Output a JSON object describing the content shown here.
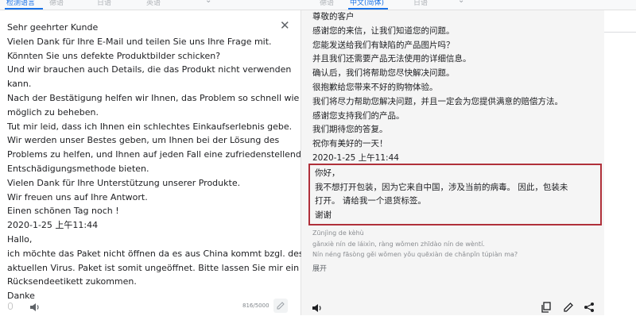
{
  "tabs": [
    {
      "label": "检测语言",
      "active": true
    },
    {
      "label": "德语"
    },
    {
      "label": "日语"
    },
    {
      "label": "英语"
    },
    {
      "label": "德语"
    },
    {
      "label": "中文(简体)",
      "active": true
    },
    {
      "label": "日语"
    }
  ],
  "source": {
    "lines": [
      "Sehr geehrter Kunde",
      "Vielen Dank für Ihre E-Mail und teilen Sie uns Ihre Frage mit.",
      "Könnten Sie uns defekte Produktbilder schicken?",
      "Und wir brauchen auch Details, die das Produkt nicht verwenden",
      "kann.",
      "Nach der Bestätigung helfen wir Ihnen, das Problem so schnell wie",
      "möglich zu beheben.",
      "Tut mir leid, dass ich Ihnen ein schlechtes Einkaufserlebnis gebe.",
      "Wir werden unser Bestes geben, um Ihnen bei der Lösung des",
      "Problems zu helfen, und Ihnen auf jeden Fall eine zufriedenstellende",
      "Entschädigungsmethode bieten.",
      "Vielen Dank für Ihre Unterstützung unserer Produkte.",
      "Wir freuen uns auf Ihre Antwort.",
      "Einen schönen Tag noch !",
      "2020-1-25 上午11:44",
      " Hallo,",
      "ich möchte das Paket nicht öffnen da es aus China kommt bzgl. des",
      "aktuellen Virus. Paket ist somit ungeöffnet. Bitte lassen Sie mir ein",
      "Rücksendeetikett zukommen.",
      "Danke"
    ],
    "char_count": "816/5000"
  },
  "target": {
    "lines": [
      "尊敬的客户",
      "感谢您的来信，让我们知道您的问题。",
      "您能发送给我们有缺陷的产品图片吗？",
      "并且我们还需要产品无法使用的详细信息。",
      "确认后，我们将帮助您尽快解决问题。",
      "很抱歉给您带来不好的购物体验。",
      "我们将尽力帮助您解决问题，并且一定会为您提供满意的赔偿方法。",
      "感谢您支持我们的产品。",
      "我们期待您的答复。",
      "祝你有美好的一天！",
      "2020-1-25 上午11:44"
    ],
    "highlighted_lines": [
      " 你好，",
      "我不想打开包装，因为它来自中国，涉及当前的病毒。 因此，包装未",
      "打开。 请给我一个退货标签。",
      "谢谢"
    ],
    "pinyin_lines": [
      "Zūnjìng de kèhù",
      "gǎnxiè nín de láixìn, ràng wǒmen zhīdào nín de wèntí.",
      "Nín néng fāsòng gěi wǒmen yǒu quēxiàn de chǎnpǐn túpiàn ma?"
    ],
    "expand_label": "展开"
  },
  "colors": {
    "accent": "#1a73e8",
    "highlight_border": "#b0303a"
  },
  "icons": [
    "close-icon",
    "mic-icon",
    "speaker-icon",
    "edit-icon",
    "copy-icon",
    "pencil-icon",
    "share-icon"
  ]
}
